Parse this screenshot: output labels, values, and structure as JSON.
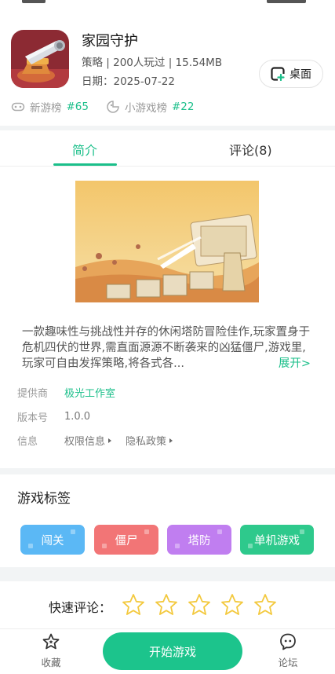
{
  "app": {
    "title": "家园守护",
    "meta": "策略 | 200人玩过 | 15.54MB",
    "date": "日期：2025-07-22",
    "desktop_button": "桌面"
  },
  "ranks": [
    {
      "label": "新游榜",
      "num": "#65"
    },
    {
      "label": "小游戏榜",
      "num": "#22"
    }
  ],
  "tabs": {
    "intro": "简介",
    "comments": "评论(8)"
  },
  "description": {
    "text": "一款趣味性与挑战性并存的休闲塔防冒险佳作,玩家置身于危机四伏的世界,需直面源源不断袭来的凶猛僵尸,游戏里,玩家可自由发挥策略,将各式各...",
    "expand": "展开>"
  },
  "info": {
    "provider_label": "提供商",
    "provider": "极光工作室",
    "version_label": "版本号",
    "version": "1.0.0",
    "info_label": "信息",
    "permissions": "权限信息",
    "privacy": "隐私政策"
  },
  "tags_section": {
    "title": "游戏标签",
    "tags": [
      {
        "label": "闯关",
        "color": "#5bb8f5"
      },
      {
        "label": "僵尸",
        "color": "#f27576"
      },
      {
        "label": "塔防",
        "color": "#c07ef0"
      },
      {
        "label": "单机游戏",
        "color": "#2ec98c"
      }
    ]
  },
  "quick_review": {
    "label": "快速评论：",
    "stars": 5,
    "star_color": "#f3c93e"
  },
  "bottom_bar": {
    "favorite": "收藏",
    "start": "开始游戏",
    "forum": "论坛"
  },
  "accent_color": "#1bbf8a"
}
